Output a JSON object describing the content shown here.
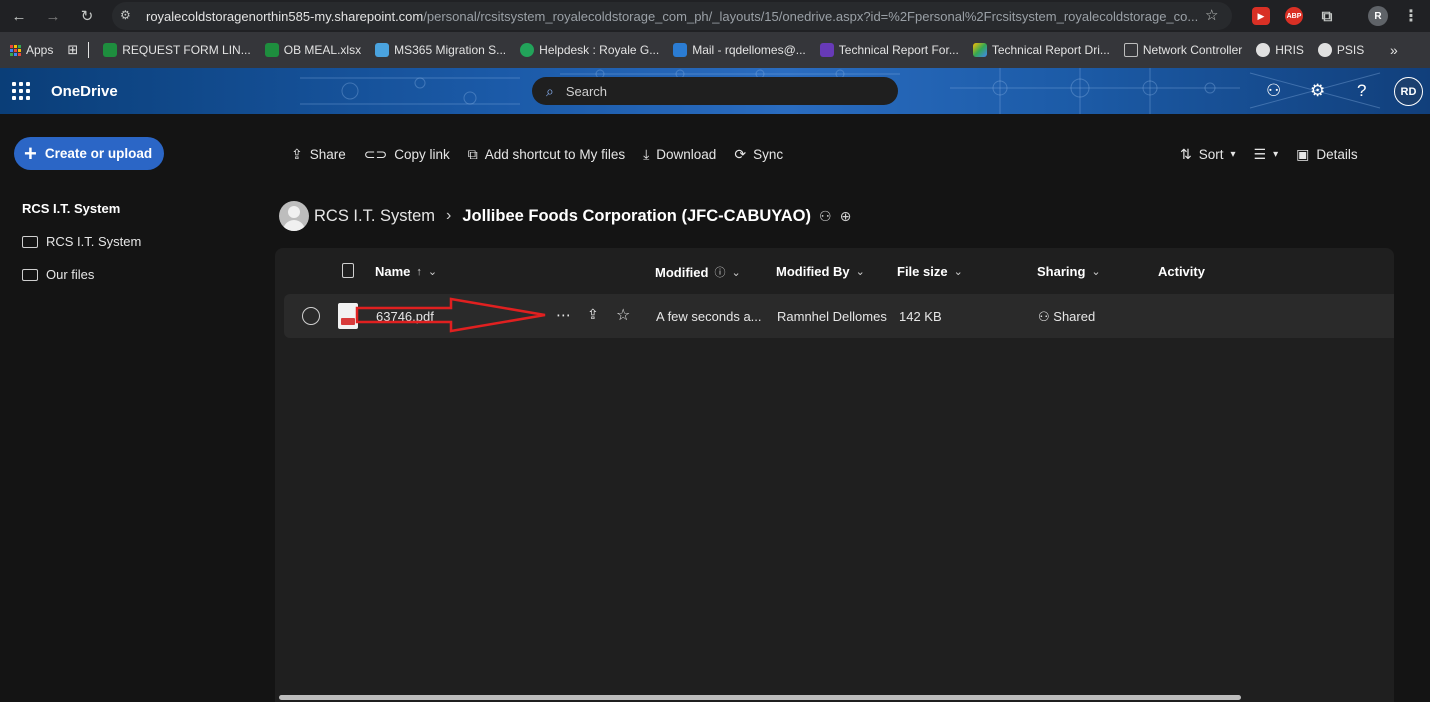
{
  "browser": {
    "url_host": "royalecoldstoragenorthin585-my.sharepoint.com",
    "url_path": "/personal/rcsitsystem_royalecoldstorage_com_ph/_layouts/15/onedrive.aspx?id=%2Fpersonal%2Frcsitsystem_royalecoldstorage_co...",
    "profile_initial": "R",
    "ext_abp": "ABP"
  },
  "bookmarks": [
    {
      "label": "Apps",
      "color": "#e8453c"
    },
    {
      "label": "REQUEST FORM LIN...",
      "color": "#1e8e3e"
    },
    {
      "label": "OB MEAL.xlsx",
      "color": "#1e8e3e"
    },
    {
      "label": "MS365 Migration S...",
      "color": "#4aa3df"
    },
    {
      "label": "Helpdesk : Royale G...",
      "color": "#22a35a"
    },
    {
      "label": "Mail - rqdellomes@...",
      "color": "#2b7cd3"
    },
    {
      "label": "Technical Report For...",
      "color": "#673ab7"
    },
    {
      "label": "Technical Report Dri...",
      "color": "#f4b400"
    },
    {
      "label": "Network Controller",
      "color": "#bdbdbd"
    },
    {
      "label": "HRIS",
      "color": "#e0e0e0"
    },
    {
      "label": "PSIS",
      "color": "#e0e0e0"
    }
  ],
  "header": {
    "app_name": "OneDrive",
    "search_placeholder": "Search",
    "user_initials": "RD"
  },
  "sidebar": {
    "create_label": "Create or upload",
    "section_title": "RCS I.T. System",
    "items": [
      {
        "label": "RCS I.T. System"
      },
      {
        "label": "Our files"
      }
    ]
  },
  "commands": {
    "share": "Share",
    "copy_link": "Copy link",
    "add_shortcut": "Add shortcut to My files",
    "download": "Download",
    "sync": "Sync",
    "sort": "Sort",
    "details": "Details"
  },
  "breadcrumb": {
    "root": "RCS I.T. System",
    "current": "Jollibee Foods Corporation (JFC-CABUYAO)"
  },
  "columns": {
    "name": "Name",
    "modified": "Modified",
    "modified_by": "Modified By",
    "file_size": "File size",
    "sharing": "Sharing",
    "activity": "Activity"
  },
  "files": [
    {
      "name": "63746.pdf",
      "modified": "A few seconds a...",
      "modified_by": "Ramnhel Dellomes",
      "file_size": "142 KB",
      "sharing": "Shared"
    }
  ],
  "colors": {
    "accent": "#2b66c6",
    "annotation_arrow": "#e02020",
    "background": "#141414"
  }
}
